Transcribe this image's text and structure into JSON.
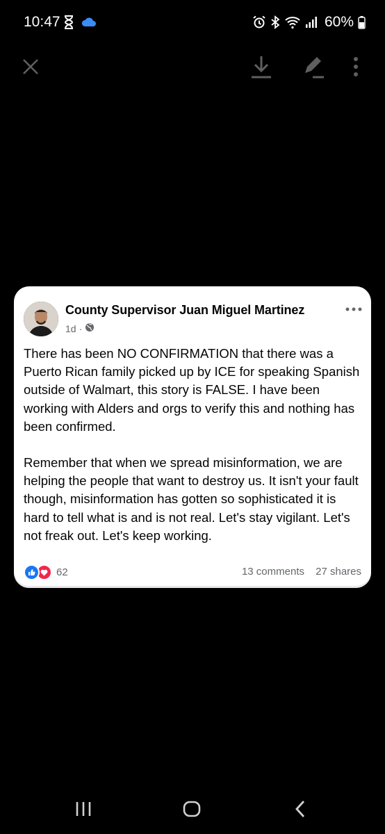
{
  "status_bar": {
    "time": "10:47",
    "battery": "60%"
  },
  "toolbar": {
    "close_icon": "close-icon",
    "download_icon": "download-icon",
    "edit_icon": "edit-icon",
    "more_icon": "more-vertical-icon"
  },
  "post": {
    "author": "County Supervisor Juan Miguel Martinez",
    "time_ago": "1d",
    "separator": "·",
    "paragraphs": [
      "There has been NO CONFIRMATION that there was a Puerto Rican family picked up by ICE for speaking Spanish outside of Walmart, this story is FALSE. I have been working with Alders and orgs to verify this and nothing has been confirmed.",
      "Remember that when we spread misinformation, we are helping the people that want to destroy us. It isn't your fault though, misinformation has gotten so sophisticated it is hard to tell what is and is not real. Let's stay vigilant. Let's not freak out. Let's keep working."
    ],
    "reaction_count": "62",
    "comments": "13 comments",
    "shares": "27 shares"
  },
  "colors": {
    "like_blue": "#1877f2",
    "love_red": "#f0284a",
    "secondary_text": "#65676b",
    "toolbar_icon": "#5f5f5f"
  }
}
